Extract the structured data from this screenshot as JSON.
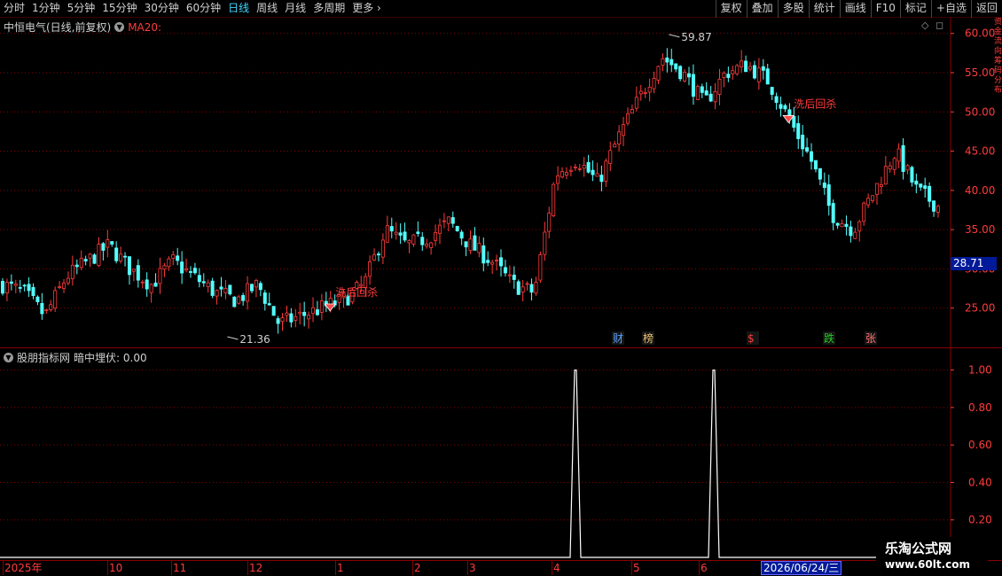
{
  "toolbar": {
    "periods": [
      "分时",
      "1分钟",
      "5分钟",
      "15分钟",
      "30分钟",
      "60分钟",
      "日线",
      "周线",
      "月线",
      "多周期",
      "更多"
    ],
    "active_period": "日线",
    "buttons": [
      "复权",
      "叠加",
      "多股",
      "统计",
      "画线",
      "F10",
      "标记",
      "+自选",
      "返回"
    ]
  },
  "main_chart": {
    "stock_name": "中恒电气(日线,前复权)",
    "ma_label": "MA20:",
    "price_tag": "28.71",
    "high_label": "59.87",
    "low_label": "21.36",
    "signals": [
      "洗后回杀",
      "洗后回杀"
    ],
    "event_markers": [
      {
        "text": "财",
        "color": "#5aa0ff"
      },
      {
        "text": "榜",
        "color": "#e8c070"
      },
      {
        "text": "$",
        "color": "#ff3b3b"
      },
      {
        "text": "跌",
        "color": "#22cc22"
      },
      {
        "text": "张",
        "color": "#ff7070"
      }
    ],
    "colors": {
      "up": "#ff3b3b",
      "down": "#54ffff",
      "grid": "#8a0000",
      "axis": "#ff3b3b"
    }
  },
  "indicator": {
    "name": "股朋指标网",
    "series_label": "暗中埋伏: 0.00"
  },
  "date_axis": {
    "labels": [
      "2025年",
      "10",
      "11",
      "12",
      "1",
      "2",
      "3",
      "4",
      "5",
      "6"
    ],
    "cursor_date": "2026/06/24/三"
  },
  "watermark": {
    "title": "乐淘公式网",
    "url": "www.60lt.com"
  },
  "side_strip_text": "资金流向筹码分布",
  "chart_data": [
    {
      "type": "candlestick",
      "title": "中恒电气(日线,前复权)",
      "ylim": [
        20,
        62
      ],
      "y_ticks": [
        25.0,
        30.0,
        35.0,
        40.0,
        45.0,
        50.0,
        55.0,
        60.0
      ],
      "annotations": {
        "high": 59.87,
        "low": 21.36,
        "last_price": 28.71
      },
      "x_months": [
        "2025年",
        "10",
        "11",
        "12",
        "1",
        "2",
        "3",
        "4",
        "5",
        "6"
      ],
      "close_trend": [
        28,
        27,
        24,
        29,
        31,
        33,
        30,
        28,
        31,
        29,
        27,
        26,
        28,
        23,
        24,
        25,
        26,
        28,
        35,
        33,
        34,
        36,
        33,
        31,
        28,
        27,
        42,
        44,
        41,
        47,
        52,
        57,
        55,
        51,
        55,
        56,
        54,
        49,
        44,
        37,
        35,
        40,
        45,
        40,
        38
      ]
    },
    {
      "type": "line",
      "title": "股朋指标网",
      "series": [
        {
          "name": "暗中埋伏",
          "spikes_at_month_index": [
            7.3,
            9.2
          ],
          "peak": 1.0,
          "baseline": 0.0
        }
      ],
      "ylim": [
        0,
        1.05
      ],
      "y_ticks": [
        0.2,
        0.4,
        0.6,
        0.8,
        1.0
      ]
    }
  ]
}
